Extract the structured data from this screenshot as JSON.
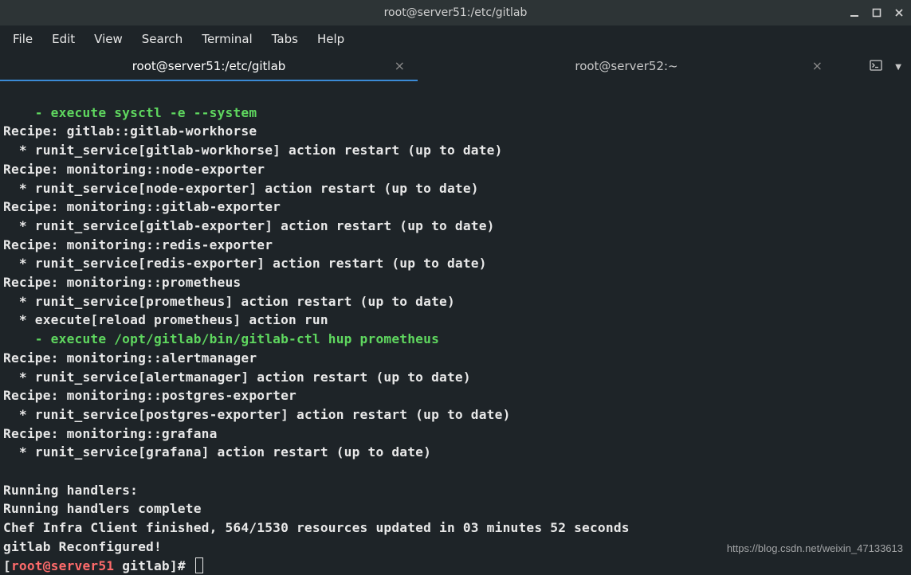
{
  "titlebar": {
    "title": "root@server51:/etc/gitlab"
  },
  "menu": {
    "file": "File",
    "edit": "Edit",
    "view": "View",
    "search": "Search",
    "terminal": "Terminal",
    "tabs": "Tabs",
    "help": "Help"
  },
  "tabs": {
    "tab1": "root@server51:/etc/gitlab",
    "tab2": "root@server52:~"
  },
  "term": {
    "l1": "    - execute sysctl -e --system",
    "l2": "Recipe: gitlab::gitlab-workhorse",
    "l3": "  * runit_service[gitlab-workhorse] action restart (up to date)",
    "l4": "Recipe: monitoring::node-exporter",
    "l5": "  * runit_service[node-exporter] action restart (up to date)",
    "l6": "Recipe: monitoring::gitlab-exporter",
    "l7": "  * runit_service[gitlab-exporter] action restart (up to date)",
    "l8": "Recipe: monitoring::redis-exporter",
    "l9": "  * runit_service[redis-exporter] action restart (up to date)",
    "l10": "Recipe: monitoring::prometheus",
    "l11": "  * runit_service[prometheus] action restart (up to date)",
    "l12": "  * execute[reload prometheus] action run",
    "l13": "    - execute /opt/gitlab/bin/gitlab-ctl hup prometheus",
    "l14": "Recipe: monitoring::alertmanager",
    "l15": "  * runit_service[alertmanager] action restart (up to date)",
    "l16": "Recipe: monitoring::postgres-exporter",
    "l17": "  * runit_service[postgres-exporter] action restart (up to date)",
    "l18": "Recipe: monitoring::grafana",
    "l19": "  * runit_service[grafana] action restart (up to date)",
    "l20": "",
    "l21": "Running handlers:",
    "l22": "Running handlers complete",
    "l23": "Chef Infra Client finished, 564/1530 resources updated in 03 minutes 52 seconds",
    "l24": "gitlab Reconfigured!",
    "prompt_open": "[",
    "prompt_user": "root@server51",
    "prompt_space": " ",
    "prompt_dir": "gitlab",
    "prompt_close": "]# "
  },
  "watermark": "https://blog.csdn.net/weixin_47133613"
}
